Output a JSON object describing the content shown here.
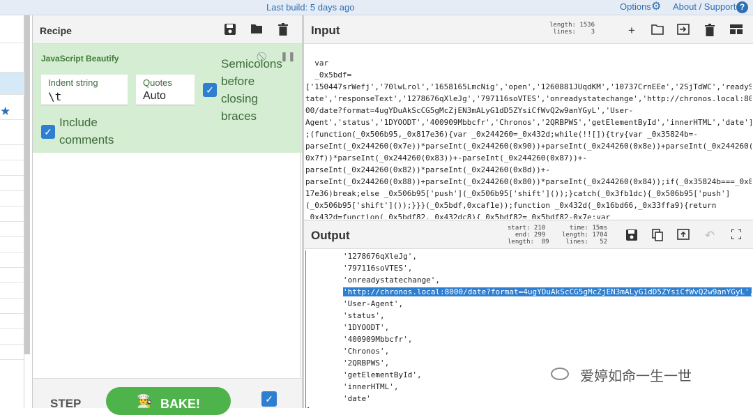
{
  "topbar": {
    "build": "Last build: 5 days ago",
    "options": "Options",
    "about": "About / Support",
    "help_icon": "question-icon",
    "gear_icon": "gear-icon"
  },
  "recipe": {
    "title": "Recipe",
    "operation": {
      "name": "JavaScript Beautify",
      "indent_label": "Indent string",
      "indent_value": "\\t",
      "quotes_label": "Quotes",
      "quotes_value": "Auto",
      "semicolons_label": "Semicolons before closing braces",
      "include_comments_label": "Include comments"
    },
    "step_label": "STEP",
    "bake_label": "BAKE!"
  },
  "input": {
    "title": "Input",
    "stats": "length: 1536\n lines:    3",
    "lines": [
      "  var",
      "  _0x5bdf=",
      "['150447srWefj','70lwLrol','1658165LmcNig','open','1260881JUqdKM','10737CrnEEe','2SjTdWC','readyS",
      "tate','responseText','1278676qXleJg','797116soVTES','onreadystatechange','http://chronos.local:80",
      "00/date?format=4ugYDuAkScCG5gMcZjEN3mALyG1dD5ZYsiCfWvQ2w9anYGyL','User-",
      "Agent','status','1DYOODT','400909Mbbcfr','Chronos','2QRBPWS','getElementById','innerHTML','date']",
      ";(function(_0x506b95,_0x817e36){var _0x244260=_0x432d;while(!![]){try{var _0x35824b=-",
      "parseInt(_0x244260(0x7e))*parseInt(_0x244260(0x90))+parseInt(_0x244260(0x8e))+parseInt(_0x244260(",
      "0x7f))*parseInt(_0x244260(0x83))+-parseInt(_0x244260(0x87))+-",
      "parseInt(_0x244260(0x82))*parseInt(_0x244260(0x8d))+-",
      "parseInt(_0x244260(0x88))+parseInt(_0x244260(0x80))*parseInt(_0x244260(0x84));if(_0x35824b===_0x8",
      "17e36)break;else _0x506b95['push'](_0x506b95['shift']());}catch(_0x3fb1dc){_0x506b95['push']",
      "(_0x506b95['shift']());}}}(_0x5bdf,0xcaf1e));function _0x432d(_0x16bd66,_0x33ffa9){return",
      "_0x432d=function(_0x5bdf82,_0x432dc8){_0x5bdf82=_0x5bdf82-0x7e;var"
    ]
  },
  "output": {
    "title": "Output",
    "stats_left": "start: 210\n  end: 299\nlength:  89",
    "stats_right": "  time: 15ms\nlength: 1704\n lines:   52",
    "lines_before": [
      "        '1278676qXleJg',",
      "        '797116soVTES',",
      "        'onreadystatechange',"
    ],
    "highlight_prefix": "        ",
    "highlight": "'http://chronos.local:8000/date?format=4ugYDuAkScCG5gMcZjEN3mALyG1dD5ZYsiCfWvQ2w9anYGyL',",
    "lines_after": [
      "        'User-Agent',",
      "        'status',",
      "        '1DYOODT',",
      "        '400909Mbbcfr',",
      "        'Chronos',",
      "        '2QRBPWS',",
      "        'getElementById',",
      "        'innerHTML',",
      "        'date'",
      "]"
    ]
  },
  "watermark": "爱婷如命一生一世"
}
